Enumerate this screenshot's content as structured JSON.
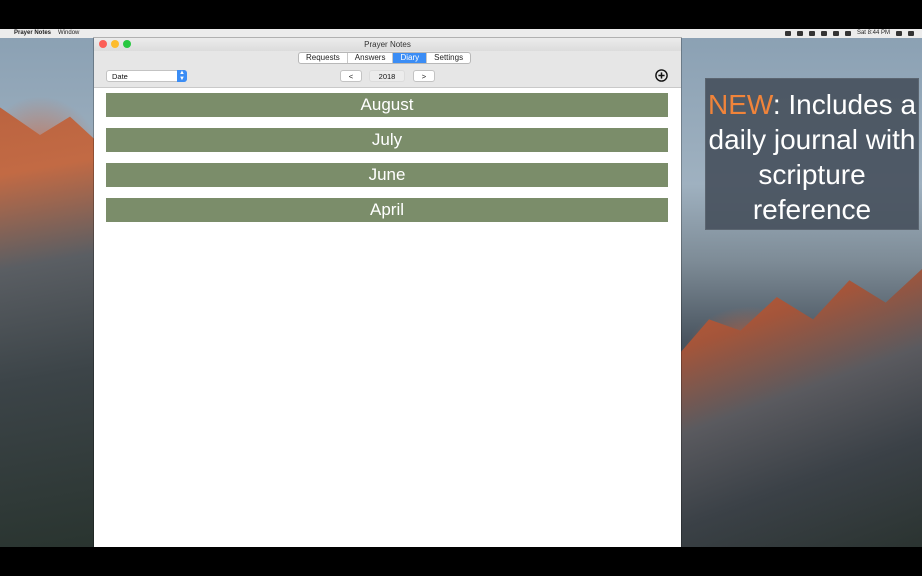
{
  "menubar": {
    "app_name": "Prayer Notes",
    "menu_window": "Window",
    "clock": "Sat 8:44 PM"
  },
  "window": {
    "title": "Prayer Notes",
    "tabs": [
      {
        "label": "Requests",
        "active": false
      },
      {
        "label": "Answers",
        "active": false
      },
      {
        "label": "Diary",
        "active": true
      },
      {
        "label": "Settings",
        "active": false
      }
    ],
    "toolbar": {
      "sort_select_value": "Date",
      "prev_label": "<",
      "year": "2018",
      "next_label": ">"
    },
    "months": [
      "August",
      "July",
      "June",
      "April"
    ]
  },
  "promo": {
    "highlight": "NEW",
    "text": ": Includes a daily journal with scripture reference"
  },
  "colors": {
    "accent": "#3b8df5",
    "month_row": "#7b8d6a",
    "promo_highlight": "#f1843a"
  }
}
